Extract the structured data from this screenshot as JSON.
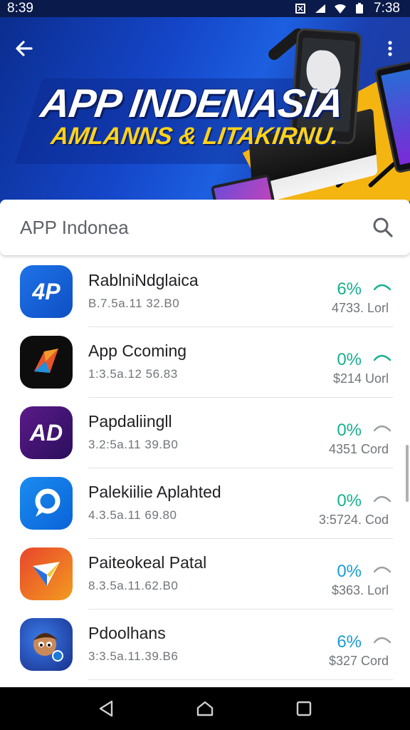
{
  "status_bar": {
    "time_left": "8:39",
    "time_right": "7:38"
  },
  "banner": {
    "title": "APP INDENASIA",
    "subtitle": "AMLANNS & LITAKIRNU."
  },
  "search": {
    "placeholder": "APP Indonea",
    "value": ""
  },
  "apps": [
    {
      "name": "RablniNdglaica",
      "meta": "B.7.5a.11 32.B0",
      "pct": "6%",
      "count": "4733. Lorl",
      "icon_label": "4P",
      "pct_color": "green"
    },
    {
      "name": "App Ccoming",
      "meta": "1:3.5a.12 56.83",
      "pct": "0%",
      "count": "$214 Uorl",
      "icon_label": "",
      "pct_color": "green"
    },
    {
      "name": "Papdaliingll",
      "meta": "3.2:5a.11 39.B0",
      "pct": "0%",
      "count": "4351 Cord",
      "icon_label": "AD",
      "pct_color": "green"
    },
    {
      "name": "Palekiilie Aplahted",
      "meta": "4.3.5a.11 69.80",
      "pct": "0%",
      "count": "3:5724. Cod",
      "icon_label": "",
      "pct_color": "green"
    },
    {
      "name": "Paiteokeal Patal",
      "meta": "8.3.5a.11.62.B0",
      "pct": "0%",
      "count": "$363. Lorl",
      "icon_label": "",
      "pct_color": "blue"
    },
    {
      "name": "Pdoolhans",
      "meta": "3:3.5a.11.39.B6",
      "pct": "6%",
      "count": "$327 Cord",
      "icon_label": "",
      "pct_color": "blue"
    }
  ],
  "colors": {
    "accent_green": "#17b08f",
    "accent_blue": "#1b9bd6",
    "banner_blue": "#1546c9",
    "banner_yellow": "#f5b511"
  },
  "icons": {
    "back": "arrow-left-icon",
    "more": "more-vert-icon",
    "search": "search-icon",
    "nav_back": "triangle-back-icon",
    "nav_home": "home-icon",
    "nav_recents": "square-recents-icon"
  }
}
